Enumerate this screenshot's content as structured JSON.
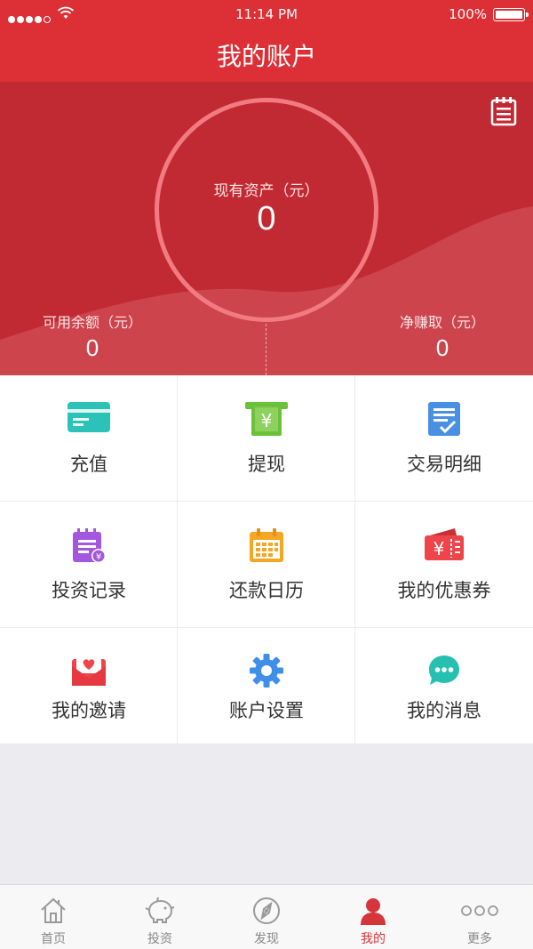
{
  "status_bar": {
    "time": "11:14 PM",
    "battery": "100%"
  },
  "nav": {
    "title": "我的账户"
  },
  "account": {
    "total_assets_label": "现有资产（元）",
    "total_assets_value": "0",
    "available_label": "可用余额（元）",
    "available_value": "0",
    "net_earned_label": "净赚取（元）",
    "net_earned_value": "0"
  },
  "menu": [
    {
      "label": "充值",
      "icon": "card-icon",
      "color": "#2bc3b7"
    },
    {
      "label": "提现",
      "icon": "atm-yen-icon",
      "color": "#6cc13b"
    },
    {
      "label": "交易明细",
      "icon": "checked-document-icon",
      "color": "#4a90e2"
    },
    {
      "label": "投资记录",
      "icon": "notepad-yen-icon",
      "color": "#a357e0"
    },
    {
      "label": "还款日历",
      "icon": "calendar-icon",
      "color": "#f5a623"
    },
    {
      "label": "我的优惠券",
      "icon": "coupon-yen-icon",
      "color": "#f0444b"
    },
    {
      "label": "我的邀请",
      "icon": "heart-envelope-icon",
      "color": "#f0444b"
    },
    {
      "label": "账户设置",
      "icon": "gear-icon",
      "color": "#3f8fe8"
    },
    {
      "label": "我的消息",
      "icon": "chat-bubble-icon",
      "color": "#26c0b0"
    }
  ],
  "tabs": [
    {
      "label": "首页",
      "icon": "home-icon"
    },
    {
      "label": "投资",
      "icon": "piggy-bank-icon"
    },
    {
      "label": "发现",
      "icon": "compass-icon"
    },
    {
      "label": "我的",
      "icon": "person-icon",
      "active": true
    },
    {
      "label": "更多",
      "icon": "more-dots-icon"
    }
  ]
}
